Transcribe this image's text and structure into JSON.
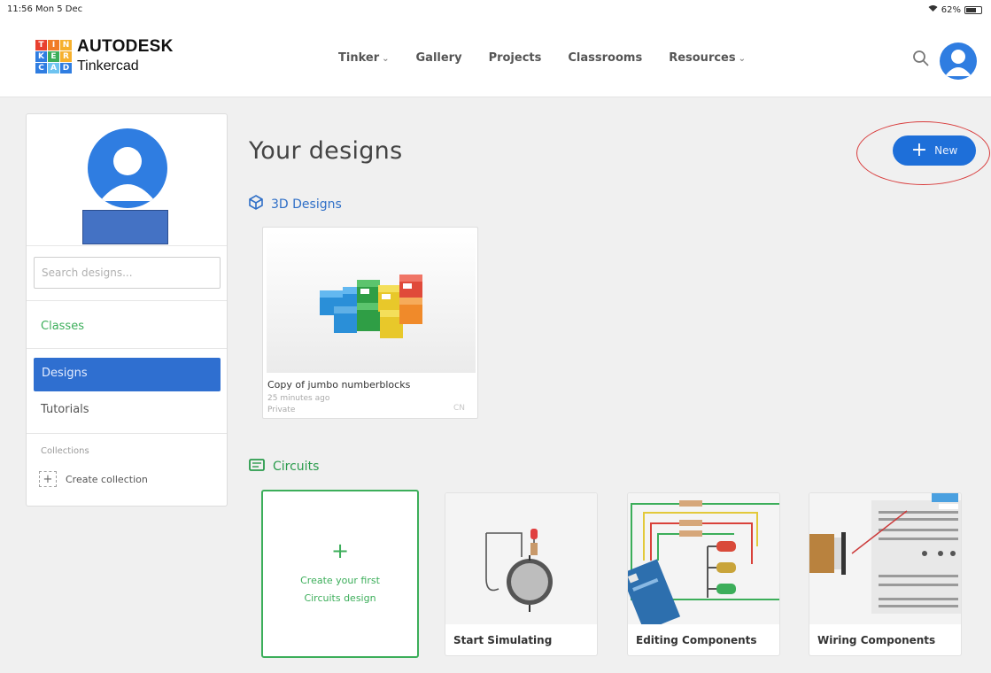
{
  "status": {
    "time": "11:56  Mon 5 Dec",
    "battery": "62%"
  },
  "brand": {
    "logo_letters": [
      "T",
      "I",
      "N",
      "K",
      "E",
      "R",
      "C",
      "A",
      "D"
    ],
    "logo_colors": [
      "#e8402f",
      "#f07c26",
      "#f6b02d",
      "#2f7de1",
      "#3cae5a",
      "#f6b02d",
      "#2f7de1",
      "#6ec3f0",
      "#2f7de1"
    ],
    "line1": "AUTODESK",
    "line2": "Tinkercad"
  },
  "nav": {
    "items": [
      {
        "label": "Tinker",
        "has_dropdown": true
      },
      {
        "label": "Gallery",
        "has_dropdown": false
      },
      {
        "label": "Projects",
        "has_dropdown": false
      },
      {
        "label": "Classrooms",
        "has_dropdown": false
      },
      {
        "label": "Resources",
        "has_dropdown": true
      }
    ],
    "search_icon": "search-icon",
    "avatar_icon": "user-avatar-icon"
  },
  "sidebar": {
    "search_placeholder": "Search designs...",
    "classes": "Classes",
    "designs": "Designs",
    "tutorials": "Tutorials",
    "collections": "Collections",
    "create_collection": "Create collection",
    "create_collection_icon": "+"
  },
  "main": {
    "title": "Your designs",
    "new_button": "New",
    "new_button_icon": "+",
    "sections": {
      "designs_3d": "3D Designs",
      "circuits": "Circuits"
    },
    "design_card": {
      "title": "Copy of jumbo numberblocks",
      "time": "25 minutes ago",
      "privacy": "Private",
      "badge": "CN"
    },
    "create_circuit": {
      "icon": "+",
      "line1": "Create your first",
      "line2": "Circuits design"
    },
    "circuit_cards": [
      {
        "label": "Start Simulating"
      },
      {
        "label": "Editing Components"
      },
      {
        "label": "Wiring Components"
      }
    ]
  },
  "colors": {
    "accent_blue": "#1e6fd9",
    "accent_green": "#3cae5a",
    "highlight_red": "#d83a3a"
  }
}
